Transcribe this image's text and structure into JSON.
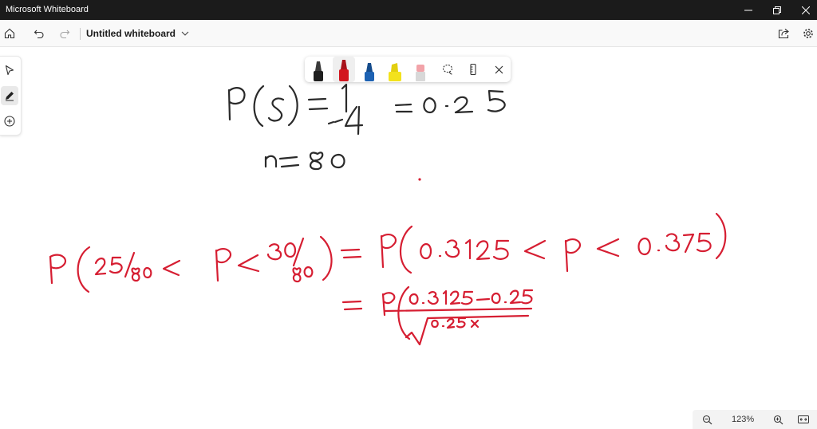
{
  "window": {
    "title": "Microsoft Whiteboard"
  },
  "toolbar": {
    "document_title": "Untitled whiteboard"
  },
  "zoom": {
    "value": "123%"
  },
  "icons": {
    "home": "home-icon",
    "undo": "undo-icon",
    "redo": "redo-icon",
    "chevron": "chevron-down-icon",
    "share": "share-icon",
    "settings": "gear-icon",
    "select": "pointer-icon",
    "draw": "pen-icon",
    "add": "add-icon",
    "lasso": "lasso-icon",
    "ruler": "ruler-icon",
    "close": "close-icon",
    "zoom_out": "zoom-out-icon",
    "zoom_in": "zoom-in-icon",
    "fit": "fit-to-screen-icon"
  },
  "pens": [
    {
      "name": "black-pen",
      "color": "#1f1f1f"
    },
    {
      "name": "red-pen",
      "color": "#d2161f",
      "selected": true
    },
    {
      "name": "blue-pen",
      "color": "#1d62b3"
    },
    {
      "name": "yellow-highlighter",
      "color": "#f3e21c"
    },
    {
      "name": "eraser",
      "color": "#f2a3a9"
    }
  ],
  "colors": {
    "ink_black": "#2a2a2a",
    "ink_red": "#d61e32",
    "titlebar": "#1b1b1b"
  }
}
